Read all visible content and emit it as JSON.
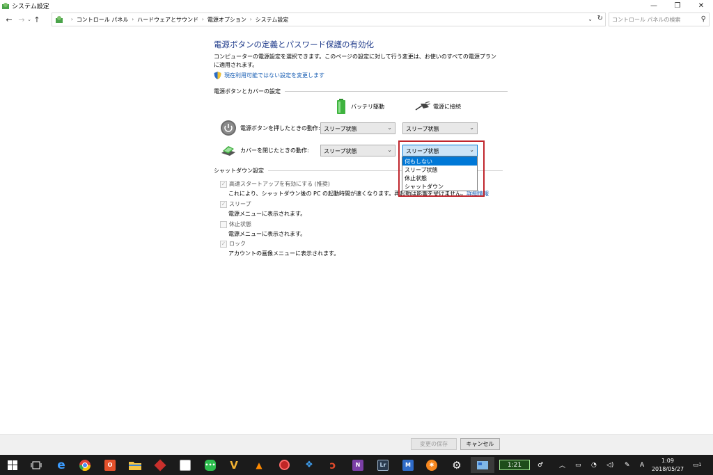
{
  "window": {
    "title": "システム設定",
    "controls": {
      "minimize": "—",
      "restore": "❐",
      "close": "✕"
    }
  },
  "address": {
    "crumbs": [
      "コントロール パネル",
      "ハードウェアとサウンド",
      "電源オプション",
      "システム設定"
    ],
    "search_placeholder": "コントロール パネルの検索"
  },
  "page": {
    "title": "電源ボタンの定義とパスワード保護の有効化",
    "description": "コンピューターの電源設定を選択できます。このページの設定に対して行う変更は、お使いのすべての電源プランに適用されます。",
    "change_link": "現在利用可能ではない設定を変更します"
  },
  "power_section": {
    "heading": "電源ボタンとカバーの設定",
    "columns": {
      "battery": "バッテリ駆動",
      "plugged": "電源に接続"
    },
    "rows": [
      {
        "label": "電源ボタンを押したときの動作:",
        "battery": "スリープ状態",
        "plugged": "スリープ状態"
      },
      {
        "label": "カバーを閉じたときの動作:",
        "battery": "スリープ状態",
        "plugged": "スリープ状態"
      }
    ],
    "dropdown_options": [
      "何もしない",
      "スリープ状態",
      "休止状態",
      "シャットダウン"
    ],
    "dropdown_highlighted": "何もしない"
  },
  "shutdown_section": {
    "heading": "シャットダウン設定",
    "options": [
      {
        "label": "高速スタートアップを有効にする (推奨)",
        "checked": true,
        "desc": "これにより、シャットダウン後の PC の起動時間が速くなります。再起動は影響を受けません。",
        "more": "詳細情報"
      },
      {
        "label": "スリープ",
        "checked": true,
        "desc": "電源メニューに表示されます。"
      },
      {
        "label": "休止状態",
        "checked": false,
        "desc": "電源メニューに表示されます。"
      },
      {
        "label": "ロック",
        "checked": true,
        "desc": "アカウントの画像メニューに表示されます。"
      }
    ]
  },
  "footer": {
    "save": "変更の保存",
    "cancel": "キャンセル"
  },
  "taskbar": {
    "battery": "1:21",
    "ime": "A",
    "time": "1:09",
    "date": "2018/05/27",
    "notifications": "1",
    "app_letters": {
      "office": "O",
      "onenote": "N",
      "lightroom": "Lr"
    }
  }
}
